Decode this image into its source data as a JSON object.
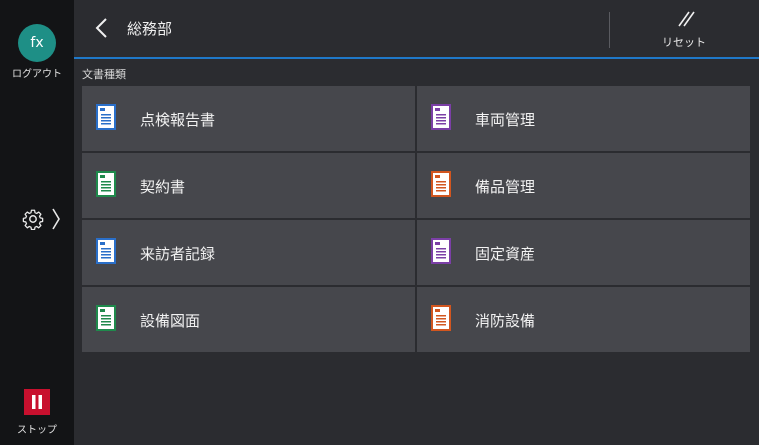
{
  "sidebar": {
    "logout_badge": "fx",
    "logout_label": "ログアウト",
    "stop_label": "ストップ"
  },
  "header": {
    "title": "総務部",
    "reset_label": "リセット"
  },
  "section": {
    "label": "文書種類"
  },
  "tiles": [
    {
      "label": "点検報告書",
      "icon": "document-icon",
      "color": "#2a6fc9"
    },
    {
      "label": "車両管理",
      "icon": "document-icon",
      "color": "#7b3fa6"
    },
    {
      "label": "契約書",
      "icon": "document-icon",
      "color": "#1f8a4c"
    },
    {
      "label": "備品管理",
      "icon": "document-icon",
      "color": "#d2561f"
    },
    {
      "label": "来訪者記録",
      "icon": "document-icon",
      "color": "#2a6fc9"
    },
    {
      "label": "固定資産",
      "icon": "document-icon",
      "color": "#7b3fa6"
    },
    {
      "label": "設備図面",
      "icon": "document-icon",
      "color": "#1f8a4c"
    },
    {
      "label": "消防設備",
      "icon": "document-icon",
      "color": "#d2561f"
    }
  ],
  "colors": {
    "accent_line": "#1f78c8",
    "logout_teal": "#1e8f86",
    "stop_red": "#c8102e",
    "tile_bg": "#46474c"
  }
}
